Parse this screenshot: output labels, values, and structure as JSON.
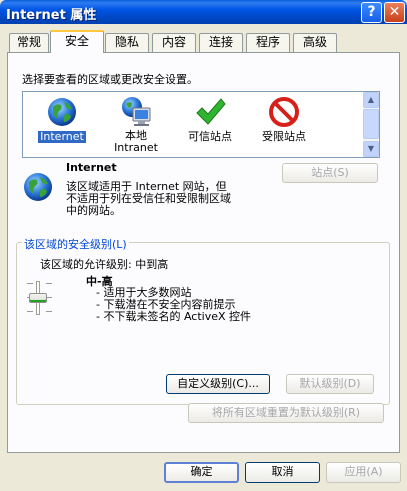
{
  "window": {
    "title": "Internet 属性",
    "help_label": "?",
    "close_label": "✕"
  },
  "tabs": [
    {
      "label": "常规"
    },
    {
      "label": "安全"
    },
    {
      "label": "隐私"
    },
    {
      "label": "内容"
    },
    {
      "label": "连接"
    },
    {
      "label": "程序"
    },
    {
      "label": "高级"
    }
  ],
  "active_tab": "安全",
  "security": {
    "instruction": "选择要查看的区域或更改安全设置。",
    "zones": [
      {
        "label": "Internet",
        "icon": "globe-icon",
        "selected": true
      },
      {
        "label": "本地\nIntranet",
        "icon": "intranet-icon",
        "selected": false
      },
      {
        "label": "可信站点",
        "icon": "checkmark-icon",
        "selected": false
      },
      {
        "label": "受限站点",
        "icon": "restricted-icon",
        "selected": false
      }
    ],
    "zone_title": "Internet",
    "zone_description": "该区域适用于 Internet 网站，但\n不适用于列在受信任和受限制区域\n中的网站。",
    "sites_button": "站点(S)",
    "level_group_label": "该区域的安全级别(L)",
    "allowed_level_text": "该区域的允许级别: 中到高",
    "level_name": "中-高",
    "level_bullets": [
      "- 适用于大多数网站",
      "- 下载潜在不安全内容前提示",
      "- 不下载未签名的 ActiveX 控件"
    ],
    "custom_level_button": "自定义级别(C)...",
    "default_level_button": "默认级别(D)",
    "reset_all_button": "将所有区域重置为默认级别(R)"
  },
  "footer": {
    "ok_label": "确定",
    "cancel_label": "取消",
    "apply_label": "应用(A)"
  },
  "colors": {
    "titlebar": "#0055E5",
    "selection": "#316AC5",
    "group_label": "#0046D5"
  }
}
